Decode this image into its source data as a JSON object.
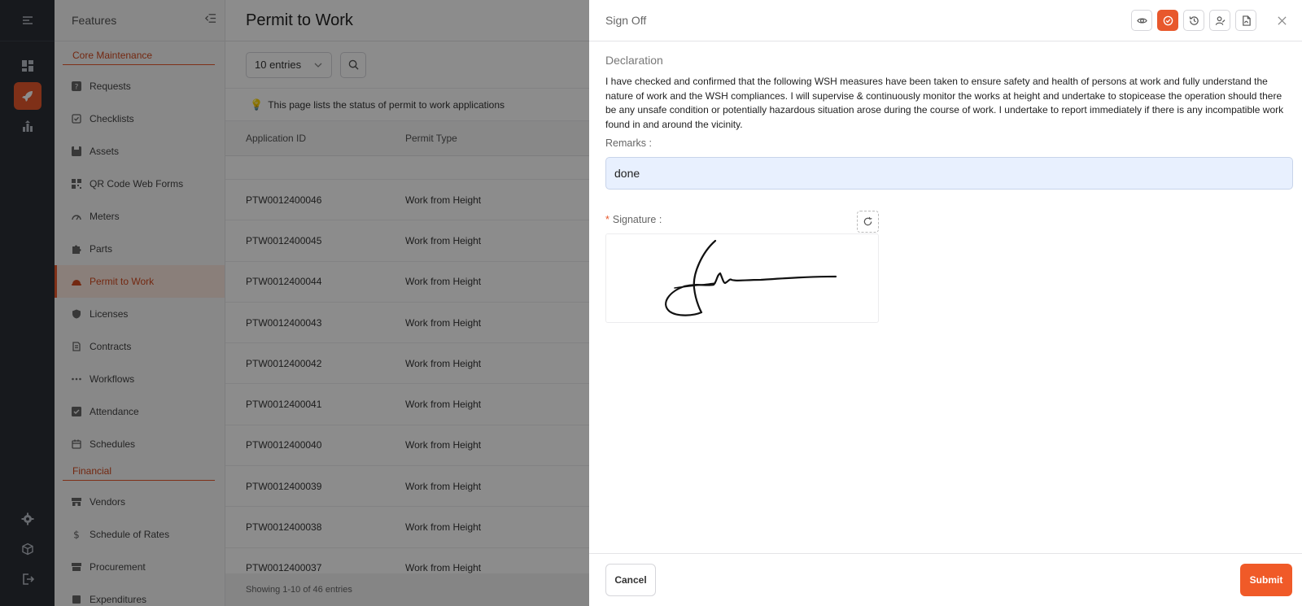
{
  "rail": {
    "top_icon": "menu-fold-icon",
    "items": [
      {
        "icon": "dashboard-icon",
        "active": false
      },
      {
        "icon": "rocket-icon",
        "active": true
      },
      {
        "icon": "chart-icon",
        "active": false
      }
    ],
    "bottom": [
      {
        "icon": "gear-icon"
      },
      {
        "icon": "cube-icon"
      },
      {
        "icon": "logout-icon"
      }
    ]
  },
  "menu": {
    "title": "Features",
    "section_core": "Core Maintenance",
    "core_items": [
      {
        "label": "Requests",
        "icon": "question-icon"
      },
      {
        "label": "Checklists",
        "icon": "checklist-icon"
      },
      {
        "label": "Assets",
        "icon": "asset-icon"
      },
      {
        "label": "QR Code Web Forms",
        "icon": "qr-icon"
      },
      {
        "label": "Meters",
        "icon": "meter-icon"
      },
      {
        "label": "Parts",
        "icon": "puzzle-icon"
      },
      {
        "label": "Permit to Work",
        "icon": "helmet-icon",
        "active": true
      },
      {
        "label": "Licenses",
        "icon": "shield-icon"
      },
      {
        "label": "Contracts",
        "icon": "contract-icon"
      },
      {
        "label": "Workflows",
        "icon": "dots-icon"
      },
      {
        "label": "Attendance",
        "icon": "attendance-icon"
      },
      {
        "label": "Schedules",
        "icon": "calendar-icon"
      }
    ],
    "section_financial": "Financial",
    "financial_items": [
      {
        "label": "Vendors",
        "icon": "store-icon"
      },
      {
        "label": "Schedule of Rates",
        "icon": "dollar-icon"
      },
      {
        "label": "Procurement",
        "icon": "procurement-icon"
      },
      {
        "label": "Expenditures",
        "icon": "expenditure-icon"
      }
    ]
  },
  "main": {
    "title": "Permit to Work",
    "entries_select": "10 entries",
    "info_text": "This page lists the status of permit to work applications",
    "columns": [
      "Application ID",
      "Permit Type"
    ],
    "rows": [
      {
        "id": "PTW0012400046",
        "type": "Work from Height"
      },
      {
        "id": "PTW0012400045",
        "type": "Work from Height"
      },
      {
        "id": "PTW0012400044",
        "type": "Work from Height"
      },
      {
        "id": "PTW0012400043",
        "type": "Work from Height"
      },
      {
        "id": "PTW0012400042",
        "type": "Work from Height"
      },
      {
        "id": "PTW0012400041",
        "type": "Work from Height"
      },
      {
        "id": "PTW0012400040",
        "type": "Work from Height"
      },
      {
        "id": "PTW0012400039",
        "type": "Work from Height"
      },
      {
        "id": "PTW0012400038",
        "type": "Work from Height"
      },
      {
        "id": "PTW0012400037",
        "type": "Work from Height"
      }
    ],
    "showing": "Showing 1-10 of 46 entries"
  },
  "drawer": {
    "title": "Sign Off",
    "actions": [
      {
        "icon": "eye-icon",
        "active": false
      },
      {
        "icon": "check-circle-icon",
        "active": true
      },
      {
        "icon": "history-icon",
        "active": false
      },
      {
        "icon": "user-sign-icon",
        "active": false
      },
      {
        "icon": "pdf-icon",
        "active": false
      }
    ],
    "declaration_title": "Declaration",
    "declaration_text": "I have checked and confirmed that the following WSH measures have been taken to ensure safety and health of persons at work and fully understand the nature of work and the WSH compliances. I will supervise & continuously monitor the works at height and undertake to stopicease the operation should there be any unsafe condition or potentially hazardous situation arose during the course of work. I undertake to report immediately if there is any incompatible work found in and around the vicinity.",
    "remarks_label": "Remarks :",
    "remarks_value": "done",
    "required_mark": "*",
    "signature_label": "Signature :",
    "cancel_label": "Cancel",
    "submit_label": "Submit"
  },
  "colors": {
    "accent": "#e8582c",
    "submit": "#f05a28",
    "rail_bg": "#2b2f36",
    "remarks_bg": "#e8f0fe"
  }
}
